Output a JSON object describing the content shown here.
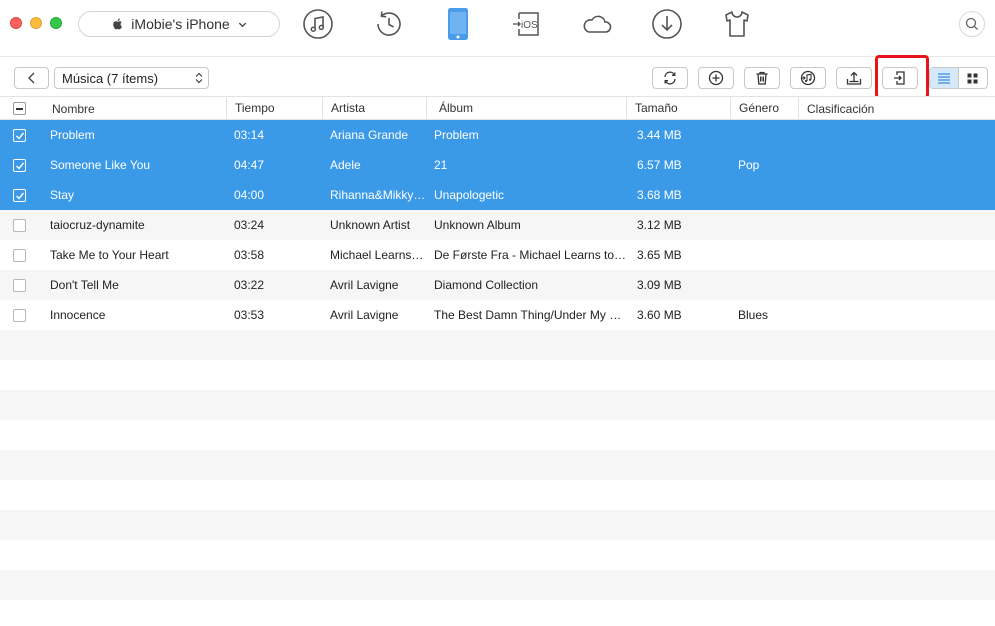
{
  "titlebar": {
    "device_name": "iMobie's iPhone",
    "nav_icons": [
      "music-icon",
      "history-icon",
      "phone-icon",
      "to-ios-icon",
      "cloud-icon",
      "download-icon",
      "tshirt-icon"
    ],
    "to_ios_label": "iOS"
  },
  "toolbar": {
    "category": "Música (7 ítems)"
  },
  "columns": [
    "Nombre",
    "Tiempo",
    "Artista",
    "Álbum",
    "Tamaño",
    "Género",
    "Clasificación"
  ],
  "rows": [
    {
      "name": "Problem",
      "time": "03:14",
      "artist": "Ariana Grande",
      "album": "Problem",
      "size": "3.44 MB",
      "genre": "",
      "rating": "",
      "selected": true
    },
    {
      "name": "Someone Like You",
      "time": "04:47",
      "artist": "Adele",
      "album": "21",
      "size": "6.57 MB",
      "genre": "Pop",
      "rating": "",
      "selected": true
    },
    {
      "name": "Stay",
      "time": "04:00",
      "artist": "Rihanna&Mikky…",
      "album": "Unapologetic",
      "size": "3.68 MB",
      "genre": "",
      "rating": "",
      "selected": true
    },
    {
      "name": "taiocruz-dynamite",
      "time": "03:24",
      "artist": "Unknown Artist",
      "album": "Unknown Album",
      "size": "3.12 MB",
      "genre": "",
      "rating": "",
      "selected": false
    },
    {
      "name": "Take Me to Your Heart",
      "time": "03:58",
      "artist": "Michael Learns…",
      "album": "De Første Fra - Michael Learns to…",
      "size": "3.65 MB",
      "genre": "",
      "rating": "",
      "selected": false
    },
    {
      "name": "Don't Tell Me",
      "time": "03:22",
      "artist": "Avril Lavigne",
      "album": "Diamond Collection",
      "size": "3.09 MB",
      "genre": "",
      "rating": "",
      "selected": false
    },
    {
      "name": "Innocence",
      "time": "03:53",
      "artist": "Avril Lavigne",
      "album": "The Best Damn Thing/Under My Skin",
      "size": "3.60 MB",
      "genre": "Blues",
      "rating": "",
      "selected": false
    }
  ],
  "colors": {
    "selection": "#3a9ae8",
    "active_nav": "#4a9be8",
    "highlight": "#e8131b"
  }
}
